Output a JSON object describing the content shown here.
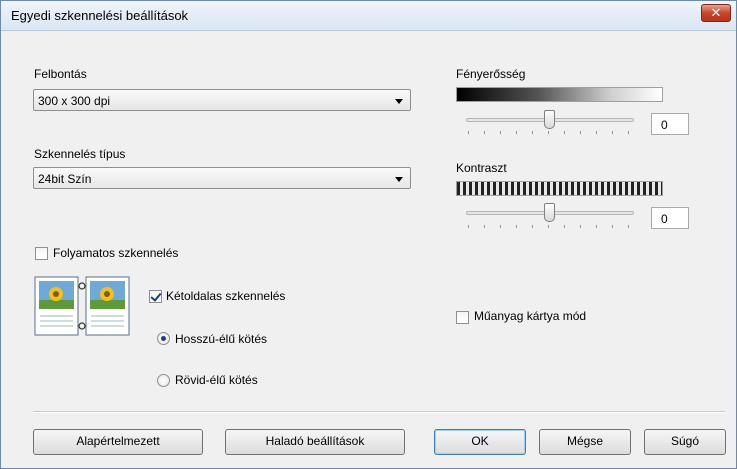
{
  "window": {
    "title": "Egyedi szkennelési beállítások",
    "close_glyph": "✕"
  },
  "resolution": {
    "label": "Felbontás",
    "value": "300 x 300 dpi"
  },
  "scan_type": {
    "label": "Szkennelés típus",
    "value": "24bit Szín"
  },
  "brightness": {
    "label": "Fényerősség",
    "value": "0",
    "level": 0.5
  },
  "contrast": {
    "label": "Kontraszt",
    "value": "0",
    "level": 0.5
  },
  "continuous_scan": {
    "label": "Folyamatos szkennelés",
    "checked": false
  },
  "duplex": {
    "label": "Kétoldalas szkennelés",
    "checked": true,
    "long_edge": {
      "label": "Hosszú-élű kötés",
      "selected": true
    },
    "short_edge": {
      "label": "Rövid-élű kötés",
      "selected": false
    }
  },
  "plastic_card": {
    "label": "Műanyag kártya mód",
    "checked": false
  },
  "buttons": {
    "default_label": "Alapértelmezett",
    "advanced_label": "Haladó beállítások",
    "ok_label": "OK",
    "cancel_label": "Mégse",
    "help_label": "Súgó"
  }
}
